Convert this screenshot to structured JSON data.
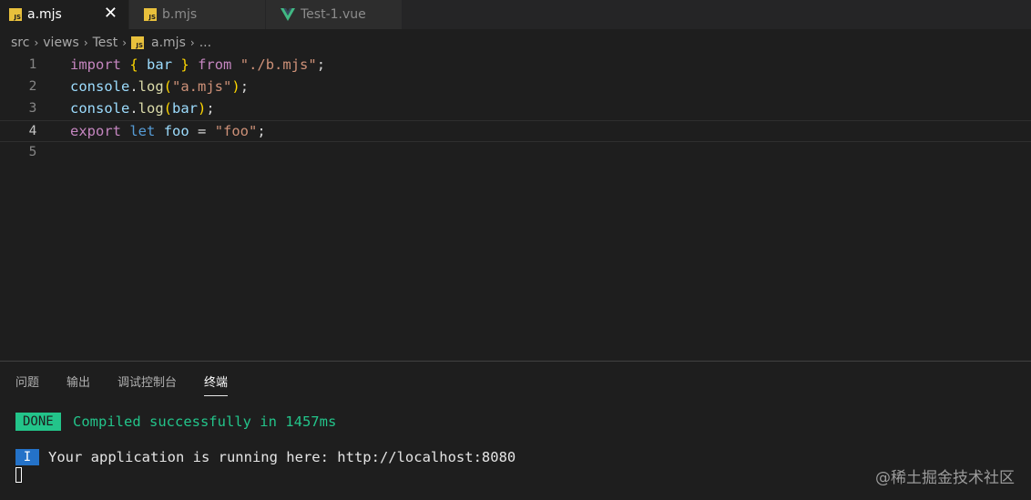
{
  "tabs": [
    {
      "label": "a.mjs",
      "icon": "js-icon",
      "active": true
    },
    {
      "label": "b.mjs",
      "icon": "js-icon",
      "active": false
    },
    {
      "label": "Test-1.vue",
      "icon": "vue-icon",
      "active": false
    }
  ],
  "tab_close": "✕",
  "js_badge": "JS",
  "breadcrumb": {
    "items": [
      "src",
      "views",
      "Test",
      "a.mjs",
      "..."
    ],
    "separator": "›"
  },
  "editor": {
    "line_numbers": [
      "1",
      "2",
      "3",
      "4",
      "5"
    ],
    "current_line": "4",
    "lines": [
      [
        [
          "kw",
          "import"
        ],
        [
          "pl",
          " "
        ],
        [
          "br",
          "{"
        ],
        [
          "pl",
          " "
        ],
        [
          "var",
          "bar"
        ],
        [
          "pl",
          " "
        ],
        [
          "br",
          "}"
        ],
        [
          "pl",
          " "
        ],
        [
          "kw",
          "from"
        ],
        [
          "pl",
          " "
        ],
        [
          "str",
          "\"./b.mjs\""
        ],
        [
          "pl",
          ";"
        ]
      ],
      [
        [
          "var",
          "console"
        ],
        [
          "pl",
          "."
        ],
        [
          "fn",
          "log"
        ],
        [
          "br",
          "("
        ],
        [
          "str",
          "\"a.mjs\""
        ],
        [
          "br",
          ")"
        ],
        [
          "pl",
          ";"
        ]
      ],
      [
        [
          "var",
          "console"
        ],
        [
          "pl",
          "."
        ],
        [
          "fn",
          "log"
        ],
        [
          "br",
          "("
        ],
        [
          "var",
          "bar"
        ],
        [
          "br",
          ")"
        ],
        [
          "pl",
          ";"
        ]
      ],
      [
        [
          "kw",
          "export"
        ],
        [
          "pl",
          " "
        ],
        [
          "kw2",
          "let"
        ],
        [
          "pl",
          " "
        ],
        [
          "var",
          "foo"
        ],
        [
          "pl",
          " = "
        ],
        [
          "str",
          "\"foo\""
        ],
        [
          "pl",
          ";"
        ]
      ],
      []
    ]
  },
  "panel": {
    "tabs": [
      "问题",
      "输出",
      "调试控制台",
      "终端"
    ],
    "active_tab": "终端"
  },
  "terminal": {
    "done_badge": "DONE",
    "done_message": "Compiled successfully in 1457ms",
    "info_badge": "I",
    "info_message": "Your application is running here: http://localhost:8080"
  },
  "watermark": "@稀土掘金技术社区",
  "colors": {
    "editor_bg": "#1e1e1e",
    "js_icon": "#e8c03c",
    "vue_icon": "#41b883",
    "done_green": "#23c48a",
    "info_blue": "#2472c8"
  }
}
